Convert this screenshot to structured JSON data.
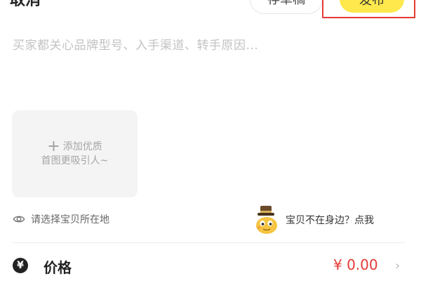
{
  "header": {
    "cancel_label": "取消",
    "draft_label": "存草稿",
    "publish_label": "发布"
  },
  "description": {
    "placeholder": "买家都关心品牌型号、入手渠道、转手原因..."
  },
  "image_picker": {
    "line1": "添加优质",
    "line2": "首图更吸引人~",
    "plus": "+"
  },
  "location": {
    "label": "请选择宝贝所在地",
    "icon": "eye-icon"
  },
  "hint": {
    "text": "宝贝不在身边？点我",
    "icon": "mascot-icon"
  },
  "price": {
    "icon_glyph": "¥",
    "label": "价格",
    "value": "¥ 0.00",
    "chevron": "›"
  },
  "colors": {
    "publish_bg": "#ffe84c",
    "highlight_border": "#e53935",
    "price_text": "#e53935"
  }
}
